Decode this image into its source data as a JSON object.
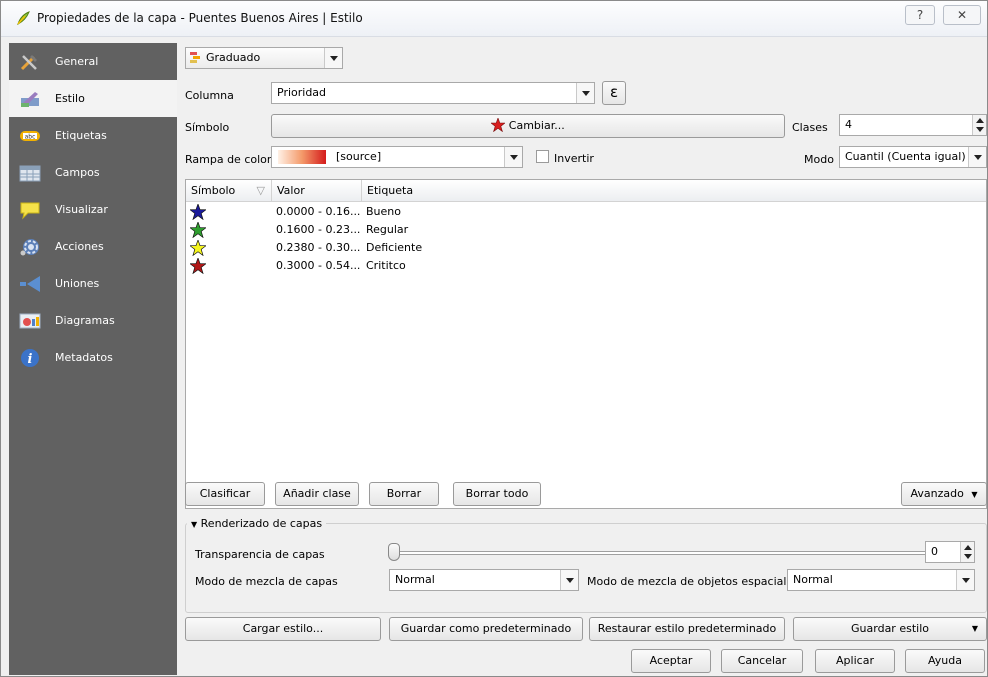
{
  "window": {
    "title": "Propiedades de la capa - Puentes Buenos Aires | Estilo",
    "help_glyph": "?",
    "close_glyph": "✕"
  },
  "sidebar": {
    "items": [
      {
        "label": "General",
        "icon": "tools-icon"
      },
      {
        "label": "Estilo",
        "icon": "paintbrush-icon"
      },
      {
        "label": "Etiquetas",
        "icon": "abc-label-icon"
      },
      {
        "label": "Campos",
        "icon": "table-icon"
      },
      {
        "label": "Visualizar",
        "icon": "speech-bubble-icon"
      },
      {
        "label": "Acciones",
        "icon": "gear-icon"
      },
      {
        "label": "Uniones",
        "icon": "join-arrow-icon"
      },
      {
        "label": "Diagramas",
        "icon": "diagram-icon"
      },
      {
        "label": "Metadatos",
        "icon": "info-icon"
      }
    ],
    "active_index": 1
  },
  "style": {
    "renderer": "Graduado",
    "column_label": "Columna",
    "column_value": "Prioridad",
    "expression_glyph": "ε",
    "symbol_label": "Símbolo",
    "change_button": "Cambiar...",
    "classes_label": "Clases",
    "classes_value": "4",
    "ramp_label": "Rampa de color",
    "ramp_value": "[source]",
    "invert_label": "Invertir",
    "mode_label": "Modo",
    "mode_value": "Cuantil (Cuenta igual)"
  },
  "table": {
    "headers": [
      "Símbolo",
      "Valor",
      "Etiqueta"
    ],
    "rows": [
      {
        "value": "0.0000 - 0.16...",
        "label": "Bueno",
        "color": "#1a1a9a"
      },
      {
        "value": "0.1600 - 0.23...",
        "label": "Regular",
        "color": "#2e9e2e"
      },
      {
        "value": "0.2380 - 0.30...",
        "label": "Deficiente",
        "color": "#f5f51e"
      },
      {
        "value": "0.3000 - 0.54...",
        "label": "Crititco",
        "color": "#b01818"
      }
    ]
  },
  "actions": {
    "classify": "Clasificar",
    "add_class": "Añadir clase",
    "delete": "Borrar",
    "delete_all": "Borrar todo",
    "advanced": "Avanzado"
  },
  "rendering": {
    "section_title": "Renderizado de capas",
    "transparency_label": "Transparencia de capas",
    "transparency_value": "0",
    "blend_label": "Modo de mezcla de capas",
    "blend_value": "Normal",
    "feature_blend_label": "Modo de mezcla de objetos espaciales",
    "feature_blend_value": "Normal"
  },
  "bottom": {
    "load_style": "Cargar estilo...",
    "save_default": "Guardar como predeterminado",
    "restore_default": "Restaurar estilo predeterminado",
    "save_style": "Guardar estilo",
    "ok": "Aceptar",
    "cancel": "Cancelar",
    "apply": "Aplicar",
    "help": "Ayuda"
  }
}
